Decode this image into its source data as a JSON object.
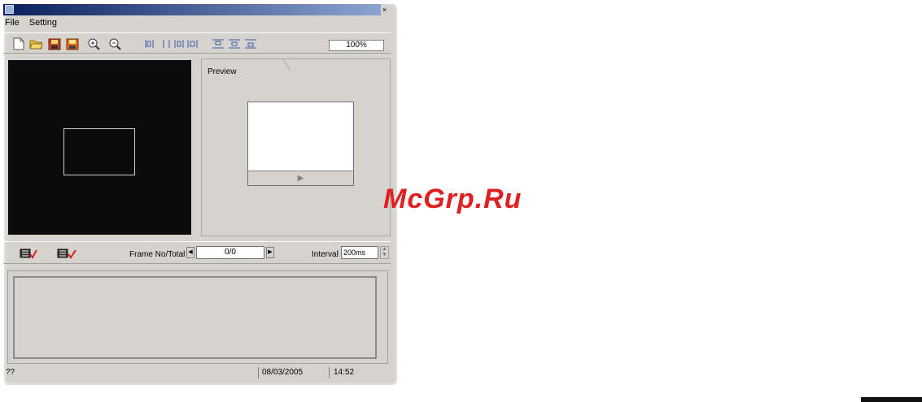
{
  "menu": {
    "file": "File",
    "setting": "Setting"
  },
  "toolbar": {
    "zoom_value": "100%",
    "icons": [
      "new-file-icon",
      "open-folder-icon",
      "save-icon",
      "save-as-icon",
      "zoom-in-icon",
      "zoom-out-icon",
      "align-left-icon",
      "align-center-icon",
      "align-right-icon",
      "align-top-icon",
      "align-middle-icon",
      "align-bottom-icon"
    ]
  },
  "preview": {
    "tab_label": "Preview",
    "play_glyph": "▶"
  },
  "controls": {
    "frame_label": "Frame No/Total",
    "frame_value": "0/0",
    "interval_label": "Interval",
    "interval_value": "200ms"
  },
  "status": {
    "left": "??",
    "date": "08/03/2005",
    "time": "14:52"
  },
  "watermark": "McGrp.Ru",
  "colors": {
    "canvas_bg": "#0b0b0b",
    "window_bg": "#d6d3ce",
    "watermark": "#e02020"
  }
}
